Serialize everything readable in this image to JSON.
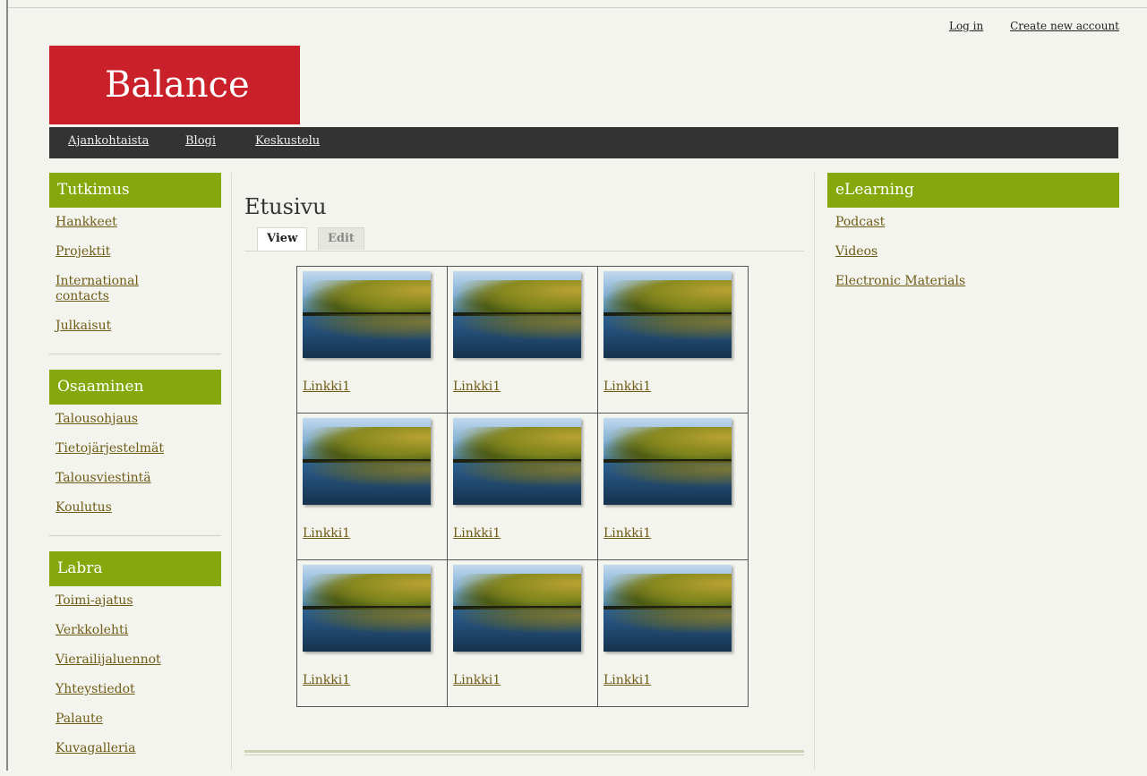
{
  "top_links": {
    "login": "Log in",
    "create_account": "Create new account"
  },
  "logo": {
    "text": "Balance"
  },
  "nav": {
    "items": [
      "Ajankohtaista",
      "Blogi",
      "Keskustelu"
    ]
  },
  "left_sidebar": {
    "blocks": [
      {
        "title": "Tutkimus",
        "items": [
          "Hankkeet",
          "Projektit",
          "International contacts",
          "Julkaisut"
        ]
      },
      {
        "title": "Osaaminen",
        "items": [
          "Talousohjaus",
          "Tietojärjestelmät",
          "Talousviestintä",
          "Koulutus"
        ]
      },
      {
        "title": "Labra",
        "items": [
          "Toimi-ajatus",
          "Verkkolehti",
          "Vierailijaluennot",
          "Yhteystiedot",
          "Palaute",
          "Kuvagalleria"
        ]
      }
    ]
  },
  "content": {
    "title": "Etusivu",
    "tabs": [
      "View",
      "Edit"
    ],
    "active_tab": "View",
    "gallery": {
      "rows": [
        [
          "Linkki1",
          "Linkki1",
          "Linkki1"
        ],
        [
          "Linkki1",
          "Linkki1",
          "Linkki1"
        ],
        [
          "Linkki1",
          "Linkki1",
          "Linkki1"
        ]
      ]
    }
  },
  "right_sidebar": {
    "blocks": [
      {
        "title": "eLearning",
        "items": [
          "Podcast",
          "Videos",
          "Electronic Materials"
        ]
      }
    ]
  },
  "colors": {
    "logo_bg": "#c9202a",
    "block_title_bg": "#86a80d",
    "nav_bg": "#333333",
    "link": "#6e5c16",
    "page_bg": "#f4f4ef"
  }
}
